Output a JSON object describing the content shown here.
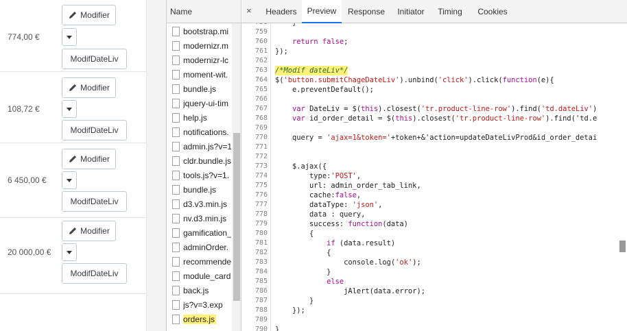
{
  "admin": {
    "modifier_label": "Modifier",
    "modifdate_label": "ModifDateLiv",
    "rows": [
      {
        "price": "774,00 €"
      },
      {
        "price": "108,72 €"
      },
      {
        "price": "6 450,00 €"
      },
      {
        "price": "20 000,00 €"
      }
    ]
  },
  "devtools": {
    "file_header": "Name",
    "files": [
      {
        "name": "bootstrap.mi"
      },
      {
        "name": "modernizr.m"
      },
      {
        "name": "modernizr-lc"
      },
      {
        "name": "moment-wit."
      },
      {
        "name": "bundle.js"
      },
      {
        "name": "jquery-ui-tim"
      },
      {
        "name": "help.js"
      },
      {
        "name": "notifications."
      },
      {
        "name": "admin.js?v=1"
      },
      {
        "name": "cldr.bundle.js"
      },
      {
        "name": "tools.js?v=1."
      },
      {
        "name": "bundle.js"
      },
      {
        "name": "d3.v3.min.js"
      },
      {
        "name": "nv.d3.min.js"
      },
      {
        "name": "gamification_"
      },
      {
        "name": "adminOrder."
      },
      {
        "name": "recommende"
      },
      {
        "name": "module_card"
      },
      {
        "name": "back.js"
      },
      {
        "name": "js?v=3.exp"
      },
      {
        "name": "orders.js",
        "highlighted": true
      }
    ],
    "close_icon": "×",
    "tabs": [
      {
        "label": "Headers"
      },
      {
        "label": "Preview",
        "active": true
      },
      {
        "label": "Response"
      },
      {
        "label": "Initiator"
      },
      {
        "label": "Timing"
      },
      {
        "label": "Cookies"
      }
    ],
    "code": [
      {
        "n": "758",
        "text": "    }"
      },
      {
        "n": "759",
        "text": ""
      },
      {
        "n": "760",
        "text": "    return false;"
      },
      {
        "n": "761",
        "text": "});"
      },
      {
        "n": "762",
        "text": ""
      },
      {
        "n": "763",
        "text": "/*Modif dateLiv*/"
      },
      {
        "n": "764",
        "text": "$('button.submitChageDateLiv').unbind('click').click(function(e){"
      },
      {
        "n": "765",
        "text": "    e.preventDefault();"
      },
      {
        "n": "766",
        "text": ""
      },
      {
        "n": "767",
        "text": "    var DateLiv = $(this).closest('tr.product-line-row').find('td.dateLiv')"
      },
      {
        "n": "768",
        "text": "    var id_order_detail = $(this).closest('tr.product-line-row').find('td.e"
      },
      {
        "n": "769",
        "text": ""
      },
      {
        "n": "770",
        "text": "    query = 'ajax=1&token='+token+&'action=updateDateLivProd&id_order_detai"
      },
      {
        "n": "771",
        "text": ""
      },
      {
        "n": "772",
        "text": ""
      },
      {
        "n": "773",
        "text": "    $.ajax({"
      },
      {
        "n": "774",
        "text": "        type:'POST',"
      },
      {
        "n": "775",
        "text": "        url: admin_order_tab_link,"
      },
      {
        "n": "776",
        "text": "        cache:false,"
      },
      {
        "n": "777",
        "text": "        dataType: 'json',"
      },
      {
        "n": "778",
        "text": "        data : query,"
      },
      {
        "n": "779",
        "text": "        success: function(data)"
      },
      {
        "n": "780",
        "text": "        {"
      },
      {
        "n": "781",
        "text": "            if (data.result)"
      },
      {
        "n": "782",
        "text": "            {"
      },
      {
        "n": "783",
        "text": "                console.log('ok');"
      },
      {
        "n": "784",
        "text": "            }"
      },
      {
        "n": "785",
        "text": "            else"
      },
      {
        "n": "786",
        "text": "                jAlert(data.error);"
      },
      {
        "n": "787",
        "text": "        }"
      },
      {
        "n": "788",
        "text": "    });"
      },
      {
        "n": "789",
        "text": ""
      },
      {
        "n": "790",
        "text": "}"
      }
    ],
    "highlight_color": "#fff27a",
    "active_tab_color": "#1a73e8"
  }
}
